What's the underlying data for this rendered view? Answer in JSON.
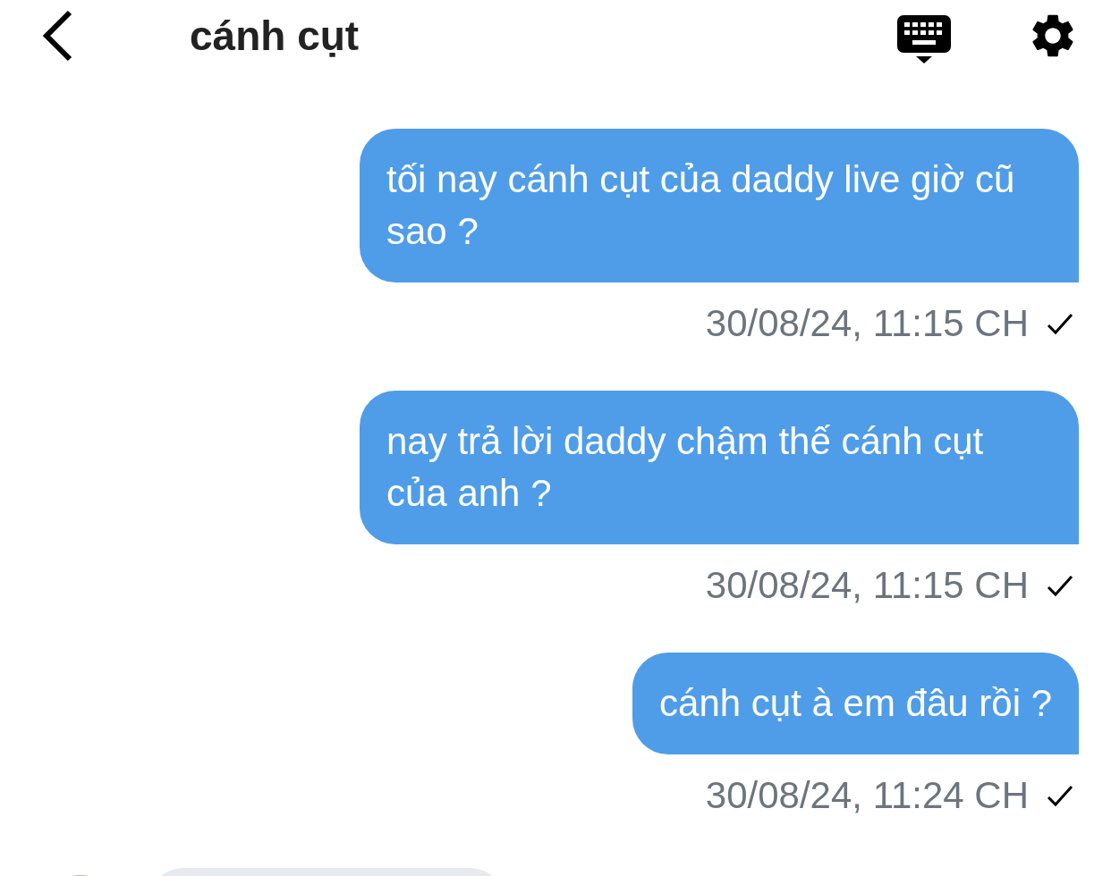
{
  "header": {
    "title": "cánh cụt"
  },
  "messages": [
    {
      "text": "tối nay cánh cụt của daddy live giờ cũ sao ?",
      "time": "30/08/24, 11:15 CH",
      "sent": true
    },
    {
      "text": "nay trả lời daddy chậm thế cánh cụt của anh ?",
      "time": "30/08/24, 11:15 CH",
      "sent": true
    },
    {
      "text": "cánh cụt à em đâu rồi ?",
      "time": "30/08/24, 11:24 CH",
      "sent": true
    }
  ]
}
